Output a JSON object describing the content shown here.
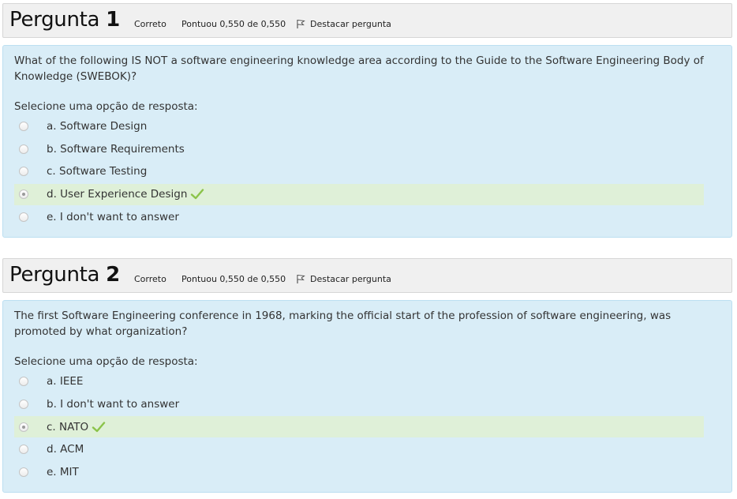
{
  "questions": [
    {
      "title_word": "Pergunta",
      "number": "1",
      "state": "Correto",
      "grade": "Pontuou 0,550 de 0,550",
      "flag_label": "Destacar pergunta",
      "text": "What of the following IS NOT a software engineering knowledge area according to the Guide to the Software Engineering Body of Knowledge (SWEBOK)?",
      "prompt": "Selecione uma opção de resposta:",
      "options": [
        {
          "label": "a. Software Design",
          "selected": false
        },
        {
          "label": "b. Software Requirements",
          "selected": false
        },
        {
          "label": "c. Software Testing",
          "selected": false
        },
        {
          "label": "d. User Experience Design",
          "selected": true
        },
        {
          "label": "e. I don't want to answer",
          "selected": false
        }
      ]
    },
    {
      "title_word": "Pergunta",
      "number": "2",
      "state": "Correto",
      "grade": "Pontuou 0,550 de 0,550",
      "flag_label": "Destacar pergunta",
      "text": "The first Software Engineering conference in 1968, marking the official start of the profession of software engineering, was promoted by what organization?",
      "prompt": "Selecione uma opção de resposta:",
      "options": [
        {
          "label": "a. IEEE",
          "selected": false
        },
        {
          "label": "b. I don't want to answer",
          "selected": false
        },
        {
          "label": "c. NATO",
          "selected": true
        },
        {
          "label": "d. ACM",
          "selected": false
        },
        {
          "label": "e. MIT",
          "selected": false
        }
      ]
    }
  ],
  "colors": {
    "header_bg": "#f0f0f0",
    "content_bg": "#d9edf7",
    "correct_bg": "#dff0d8",
    "check_mark": "#8bc34a"
  },
  "icons": {
    "flag": "flag-icon",
    "correct": "check-icon"
  }
}
